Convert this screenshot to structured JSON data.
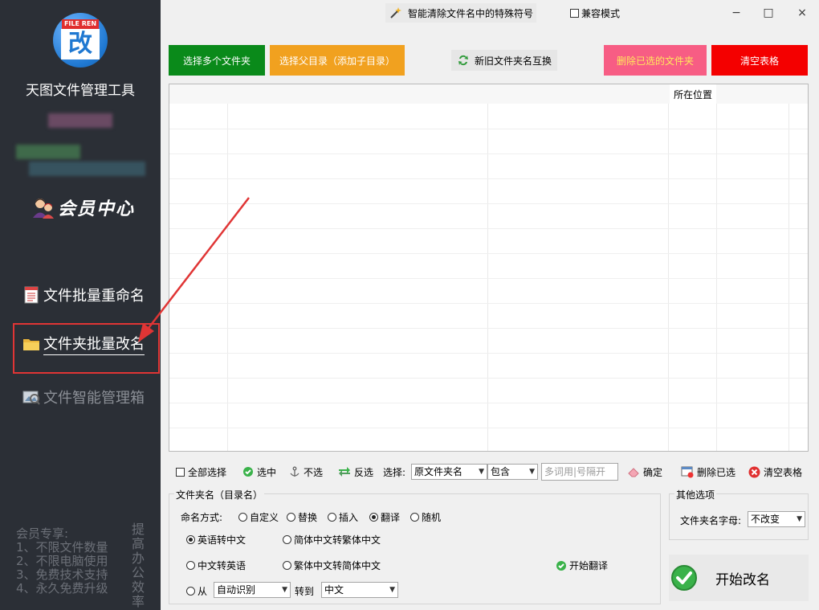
{
  "sidebar": {
    "logo_tag": "FILE REN",
    "logo_char": "改",
    "app_title": "天图文件管理工具",
    "member_label": "会员中心",
    "nav": [
      {
        "label": "文件批量重命名"
      },
      {
        "label": "文件夹批量改名"
      },
      {
        "label": "文件智能管理箱"
      }
    ],
    "perks_title": "会员专享:",
    "perks": [
      "1、不限文件数量",
      "2、不限电脑使用",
      "3、免费技术支持",
      "4、永久免费升级"
    ],
    "slogan": "提高办公效率"
  },
  "titlebar": {
    "title": "智能清除文件名中的特殊符号",
    "compat_label": "兼容模式",
    "minimize": "−",
    "maximize": "□",
    "close": "×"
  },
  "toolbar": {
    "select_multiple": "选择多个文件夹",
    "select_parent": "选择父目录（添加子目录）",
    "swap_names": "新旧文件夹名互换",
    "delete_selected": "删除已选的文件夹",
    "clear_table": "清空表格"
  },
  "table": {
    "headers": [
      "",
      "",
      "",
      "所在位置",
      "",
      ""
    ]
  },
  "filter": {
    "select_all": "全部选择",
    "check": "选中",
    "uncheck": "不选",
    "invert": "反选",
    "select_label": "选择:",
    "field_value": "原文件夹名",
    "op_value": "包含",
    "keyword_placeholder": "多词用|号隔开",
    "confirm": "确定",
    "delete_checked": "删除已选",
    "clear": "清空表格"
  },
  "naming": {
    "group_title": "文件夹名（目录名）",
    "mode_label": "命名方式:",
    "modes": [
      "自定义",
      "替换",
      "插入",
      "翻译",
      "随机"
    ],
    "selected_mode": "翻译",
    "translate_options": [
      "英语转中文",
      "简体中文转繁体中文",
      "中文转英语",
      "繁体中文转简体中文"
    ],
    "selected_translate": "英语转中文",
    "start_translate": "开始翻译",
    "from_label": "从",
    "from_value": "自动识别",
    "to_label": "转到",
    "to_value": "中文"
  },
  "other": {
    "group_title": "其他选项",
    "case_label": "文件夹名字母:",
    "case_value": "不改变",
    "start_button": "开始改名"
  }
}
